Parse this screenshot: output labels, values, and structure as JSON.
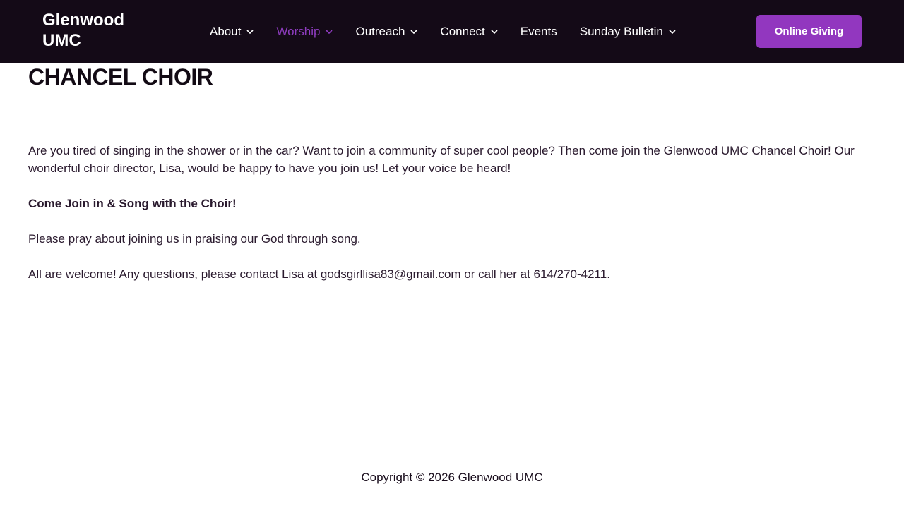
{
  "header": {
    "logo": "Glenwood UMC",
    "nav": [
      {
        "label": "About",
        "has_dropdown": true,
        "active": false
      },
      {
        "label": "Worship",
        "has_dropdown": true,
        "active": true
      },
      {
        "label": "Outreach",
        "has_dropdown": true,
        "active": false
      },
      {
        "label": "Connect",
        "has_dropdown": true,
        "active": false
      },
      {
        "label": "Events",
        "has_dropdown": false,
        "active": false
      },
      {
        "label": "Sunday Bulletin",
        "has_dropdown": true,
        "active": false
      }
    ],
    "cta_label": "Online Giving"
  },
  "page": {
    "title": "CHANCEL CHOIR",
    "paragraphs": [
      "Are you tired of singing in the shower or in the car? Want to join a community of super cool people? Then come join the Glenwood UMC Chancel Choir! Our wonderful choir director, Lisa, would be happy to have you join us! Let your voice be heard!",
      "Come Join in & Song with the Choir!",
      "Please pray about joining us in praising our God through song.",
      "All are welcome! Any questions, please contact Lisa at godsgirllisa83@gmail.com or call her at 614/270-4211."
    ]
  },
  "footer": {
    "copyright": "Copyright © 2026 Glenwood UMC"
  },
  "colors": {
    "header_bg": "#140a17",
    "accent": "#9237bf",
    "active_nav": "#8e3cbf"
  }
}
